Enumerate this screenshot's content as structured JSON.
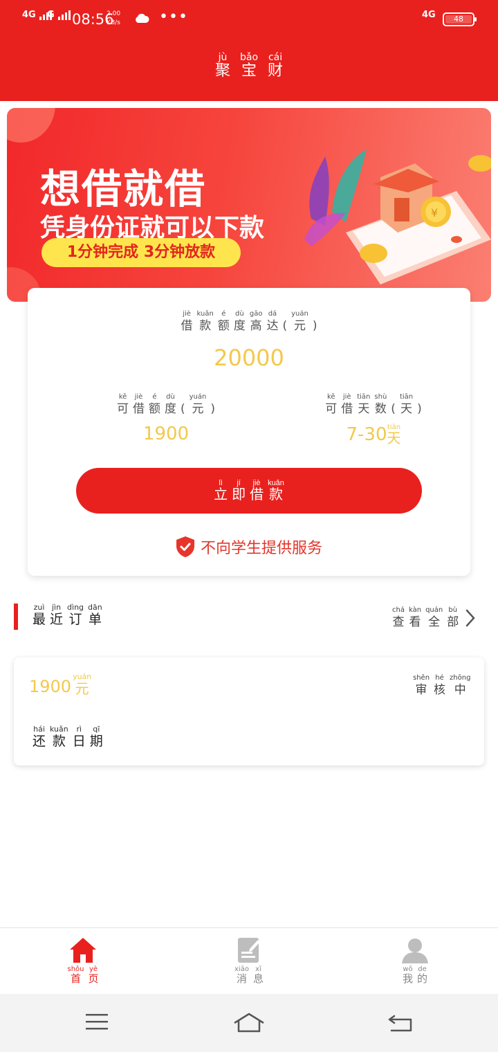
{
  "status_bar": {
    "signal1": "4G",
    "signal2": "G",
    "time": "08:56",
    "speed_value": "2.00",
    "speed_unit": "KB/s",
    "network": "4G",
    "battery": "48"
  },
  "header": {
    "title": [
      {
        "py": "jù",
        "hz": "聚"
      },
      {
        "py": "bǎo",
        "hz": "宝"
      },
      {
        "py": "cái",
        "hz": "财"
      }
    ]
  },
  "banner": {
    "line1": "想借就借",
    "line2": "凭身份证就可以下款",
    "pill": "1分钟完成 3分钟放款",
    "colors": {
      "start": "#f2282a",
      "end": "#fb7f72",
      "pill": "#ffe54d"
    }
  },
  "loan_card": {
    "max_label": [
      {
        "py": "jiè",
        "hz": "借"
      },
      {
        "py": "kuǎn",
        "hz": "款"
      },
      {
        "py": "é",
        "hz": "额"
      },
      {
        "py": "dù",
        "hz": "度"
      },
      {
        "py": "gāo",
        "hz": "高"
      },
      {
        "py": "dá",
        "hz": "达"
      },
      {
        "py": "",
        "hz": "("
      },
      {
        "py": "yuán",
        "hz": "元"
      },
      {
        "py": "",
        "hz": ")"
      }
    ],
    "max_amount": "20000",
    "available_label": [
      {
        "py": "kě",
        "hz": "可"
      },
      {
        "py": "jiè",
        "hz": "借"
      },
      {
        "py": "é",
        "hz": "额"
      },
      {
        "py": "dù",
        "hz": "度"
      },
      {
        "py": "",
        "hz": "("
      },
      {
        "py": "yuán",
        "hz": "元"
      },
      {
        "py": "",
        "hz": ")"
      }
    ],
    "available_amount": "1900",
    "days_label": [
      {
        "py": "kě",
        "hz": "可"
      },
      {
        "py": "jiè",
        "hz": "借"
      },
      {
        "py": "tiān",
        "hz": "天"
      },
      {
        "py": "shù",
        "hz": "数"
      },
      {
        "py": "",
        "hz": "("
      },
      {
        "py": "tiān",
        "hz": "天"
      },
      {
        "py": "",
        "hz": ")"
      }
    ],
    "days_range": "7-30",
    "days_unit": {
      "py": "tiān",
      "hz": "天"
    },
    "cta_label": [
      {
        "py": "lì",
        "hz": "立"
      },
      {
        "py": "jí",
        "hz": "即"
      },
      {
        "py": "jiè",
        "hz": "借"
      },
      {
        "py": "kuǎn",
        "hz": "款"
      }
    ],
    "notice": "不向学生提供服务",
    "accent": "#e8211e",
    "value_color": "#f3c84b"
  },
  "recent_orders": {
    "title": [
      {
        "py": "zuì",
        "hz": "最"
      },
      {
        "py": "jìn",
        "hz": "近"
      },
      {
        "py": "dìng",
        "hz": "订"
      },
      {
        "py": "dān",
        "hz": "单"
      }
    ],
    "view_all": [
      {
        "py": "chá",
        "hz": "查"
      },
      {
        "py": "kàn",
        "hz": "看"
      },
      {
        "py": "quán",
        "hz": "全"
      },
      {
        "py": "bù",
        "hz": "部"
      }
    ],
    "order": {
      "amount": "1900",
      "unit": {
        "py": "yuán",
        "hz": "元"
      },
      "status": [
        {
          "py": "shěn",
          "hz": "审"
        },
        {
          "py": "hé",
          "hz": "核"
        },
        {
          "py": "zhōng",
          "hz": "中"
        }
      ],
      "date_label": [
        {
          "py": "hái",
          "hz": "还"
        },
        {
          "py": "kuǎn",
          "hz": "款"
        },
        {
          "py": "rì",
          "hz": "日"
        },
        {
          "py": "qī",
          "hz": "期"
        }
      ]
    }
  },
  "tabbar": {
    "tabs": [
      {
        "icon": "home-icon",
        "label": [
          {
            "py": "shǒu",
            "hz": "首"
          },
          {
            "py": "yè",
            "hz": "页"
          }
        ],
        "active": true
      },
      {
        "icon": "message-icon",
        "label": [
          {
            "py": "xiāo",
            "hz": "消"
          },
          {
            "py": "xī",
            "hz": "息"
          }
        ],
        "active": false
      },
      {
        "icon": "profile-icon",
        "label": [
          {
            "py": "wǒ",
            "hz": "我"
          },
          {
            "py": "de",
            "hz": "的"
          }
        ],
        "active": false
      }
    ]
  },
  "system_nav": {
    "icons": [
      "menu-icon",
      "home-outline-icon",
      "back-icon"
    ]
  }
}
